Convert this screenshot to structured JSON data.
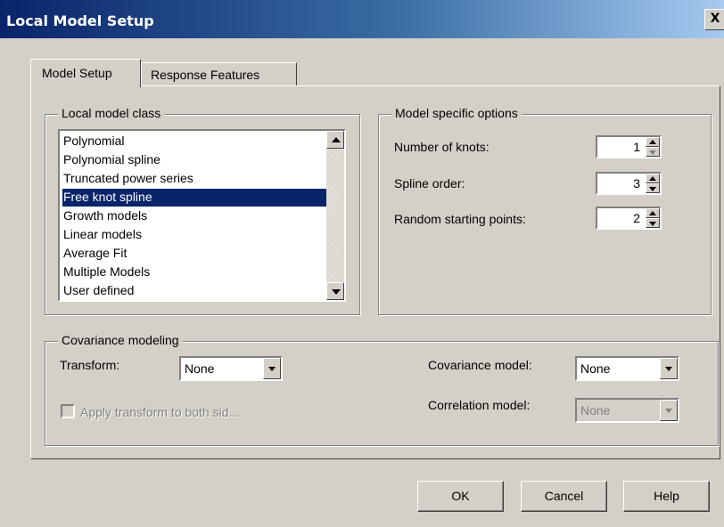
{
  "window": {
    "title": "Local Model Setup",
    "close_label": "X"
  },
  "tabs": [
    {
      "label": "Model Setup",
      "active": true
    },
    {
      "label": "Response Features",
      "active": false
    }
  ],
  "local_model_class": {
    "legend": "Local model class",
    "items": [
      "Polynomial",
      "Polynomial spline",
      "Truncated power series",
      "Free knot spline",
      "Growth models",
      "Linear models",
      "Average Fit",
      "Multiple Models",
      "User defined"
    ],
    "selected": "Free knot spline"
  },
  "model_specific_options": {
    "legend": "Model specific options",
    "knots": {
      "label": "Number of knots:",
      "value": "1"
    },
    "spline_order": {
      "label": "Spline order:",
      "value": "3"
    },
    "random_starting_points": {
      "label": "Random starting points:",
      "value": "2"
    }
  },
  "covariance": {
    "legend": "Covariance modeling",
    "transform_label": "Transform:",
    "transform_value": "None",
    "apply_transform_label": "Apply transform to both sid...",
    "covariance_model_label": "Covariance model:",
    "covariance_model_value": "None",
    "correlation_model_label": "Correlation model:",
    "correlation_model_value": "None"
  },
  "buttons": {
    "ok": "OK",
    "cancel": "Cancel",
    "help": "Help"
  },
  "colors": {
    "selection": "#0a246a",
    "face": "#d4d0c8",
    "title_start": "#0a246a",
    "title_end": "#a6caf0"
  }
}
